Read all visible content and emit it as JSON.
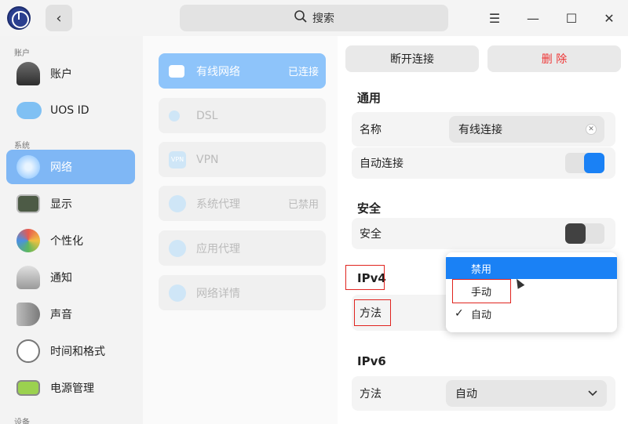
{
  "titlebar": {
    "back_icon": "‹",
    "search_placeholder": "搜索",
    "menu_icon": "☰",
    "minimize_icon": "—",
    "maximize_icon": "☐",
    "close_icon": "✕"
  },
  "sidebar": {
    "section_account": "账户",
    "section_system": "系统",
    "section_device": "设备",
    "items": [
      {
        "label": "账户",
        "icon": "user-icon"
      },
      {
        "label": "UOS ID",
        "icon": "cloud-icon"
      },
      {
        "label": "网络",
        "icon": "network-icon",
        "active": true
      },
      {
        "label": "显示",
        "icon": "monitor-icon"
      },
      {
        "label": "个性化",
        "icon": "palette-icon"
      },
      {
        "label": "通知",
        "icon": "bell-icon"
      },
      {
        "label": "声音",
        "icon": "speaker-icon"
      },
      {
        "label": "时间和格式",
        "icon": "clock-icon"
      },
      {
        "label": "电源管理",
        "icon": "battery-icon"
      }
    ]
  },
  "network_menu": [
    {
      "label": "有线网络",
      "status": "已连接",
      "active": true
    },
    {
      "label": "DSL",
      "status": ""
    },
    {
      "label": "VPN",
      "status": "",
      "icon_text": "VPN"
    },
    {
      "label": "系统代理",
      "status": "已禁用"
    },
    {
      "label": "应用代理",
      "status": ""
    },
    {
      "label": "网络详情",
      "status": ""
    }
  ],
  "details": {
    "disconnect_label": "断开连接",
    "delete_label": "删 除",
    "general_title": "通用",
    "name_label": "名称",
    "name_value": "有线连接",
    "auto_connect_label": "自动连接",
    "auto_connect_on": true,
    "security_title": "安全",
    "security_label": "安全",
    "security_on": false,
    "ipv4_title": "IPv4",
    "ipv4_method_label": "方法",
    "ipv6_title": "IPv6",
    "ipv6_method_label": "方法",
    "ipv6_method_value": "自动",
    "chevron": "⌄"
  },
  "dropdown": {
    "options": [
      "禁用",
      "手动",
      "自动"
    ],
    "highlighted": "禁用",
    "selected": "自动",
    "check": "✓"
  },
  "colors": {
    "accent": "#1a81f5",
    "sidebar_active": "#7fb7f5",
    "danger": "#e33333"
  }
}
